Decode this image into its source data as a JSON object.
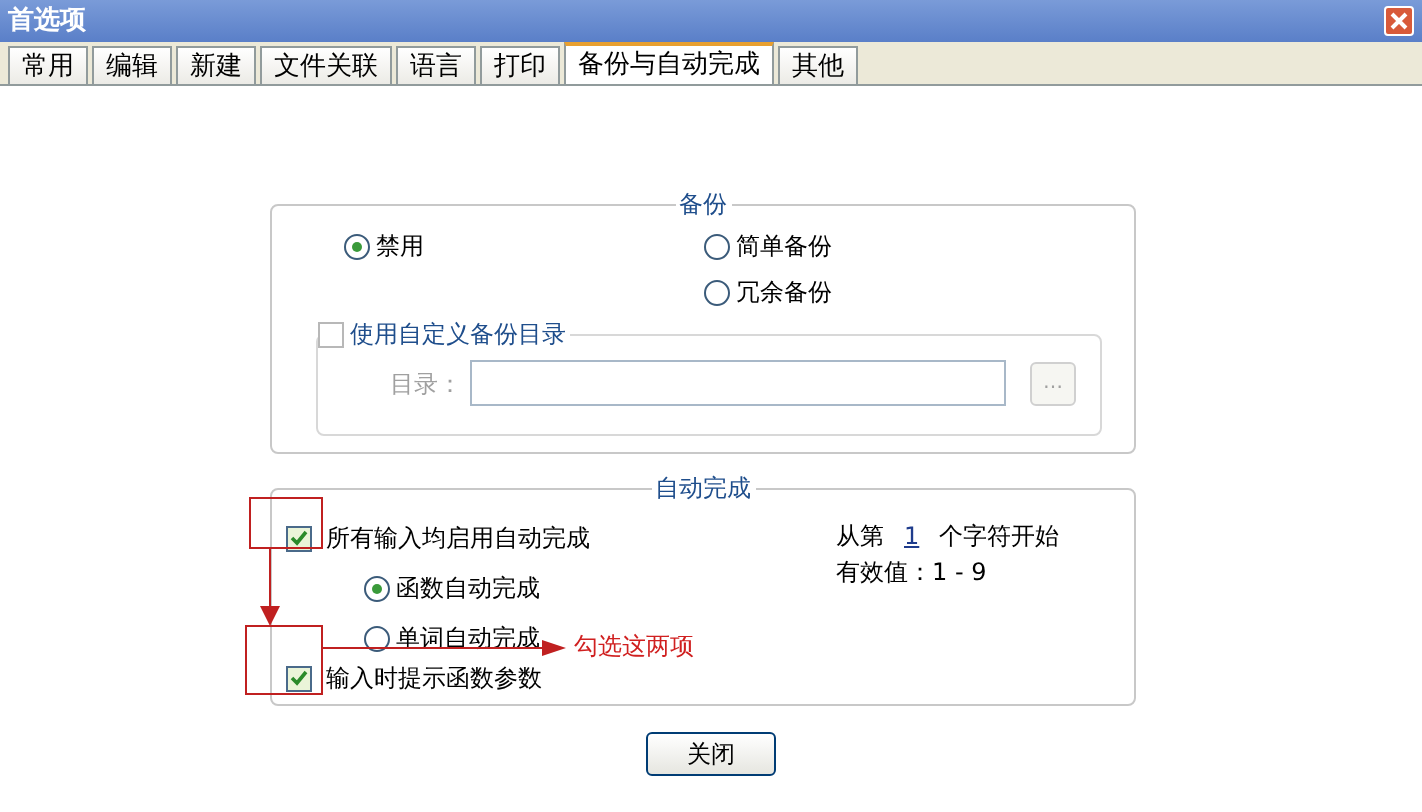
{
  "window": {
    "title": "首选项"
  },
  "tabs": [
    {
      "label": "常用",
      "selected": false
    },
    {
      "label": "编辑",
      "selected": false
    },
    {
      "label": "新建",
      "selected": false
    },
    {
      "label": "文件关联",
      "selected": false
    },
    {
      "label": "语言",
      "selected": false
    },
    {
      "label": "打印",
      "selected": false
    },
    {
      "label": "备份与自动完成",
      "selected": true
    },
    {
      "label": "其他",
      "selected": false
    }
  ],
  "backup": {
    "title": "备份",
    "options": [
      {
        "label": "禁用",
        "selected": true
      },
      {
        "label": "简单备份",
        "selected": false
      },
      {
        "label": "冗余备份",
        "selected": false
      }
    ],
    "custom_dir": {
      "label": "使用自定义备份目录",
      "checked": false,
      "dir_label": "目录：",
      "browse": "…"
    }
  },
  "autocomplete": {
    "title": "自动完成",
    "enable_all": {
      "label": "所有输入均启用自动完成",
      "checked": true
    },
    "modes": [
      {
        "label": "函数自动完成",
        "selected": true
      },
      {
        "label": "单词自动完成",
        "selected": false
      }
    ],
    "hint_params": {
      "label": "输入时提示函数参数",
      "checked": true
    },
    "start_prefix": "从第",
    "start_value": "1",
    "start_suffix": "个字符开始",
    "valid_range": "有效值：1 - 9"
  },
  "annotation": {
    "text": "勾选这两项"
  },
  "buttons": [
    {
      "label": "关闭"
    }
  ]
}
